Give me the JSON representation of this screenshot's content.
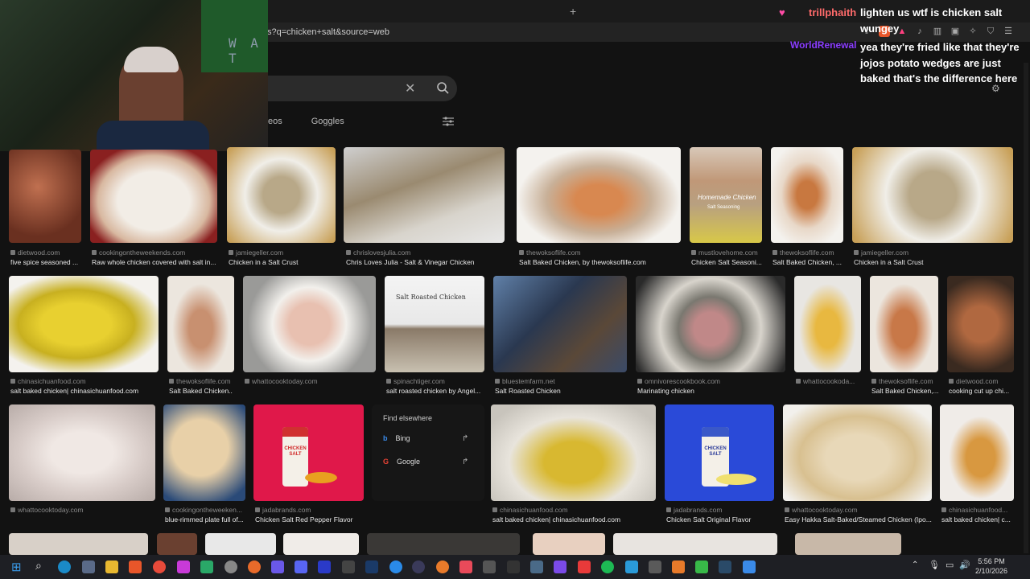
{
  "browser": {
    "url_text": "s?q=chicken+salt&source=web",
    "new_tab_label": "+"
  },
  "overlay": {
    "watermark_text": "W A T"
  },
  "search": {
    "clear_label": "✕",
    "tabs": [
      "eos",
      "Goggles"
    ]
  },
  "chat": {
    "lines": [
      {
        "user": "trillphaith",
        "text": "lighten us wtf is chicken salt"
      },
      {
        "user": "",
        "text": "wungey"
      },
      {
        "user": "WorldRenewal",
        "text": "yea they're fried like that they're jojos potato wedges are just baked that's the difference here"
      }
    ],
    "user_color_1": "#ff6b6b",
    "user_color_2": "#8a3cff"
  },
  "results": {
    "row1": [
      {
        "source": "dietwood.com",
        "caption": "five spice seasoned ..."
      },
      {
        "source": "cookingontheweekends.com",
        "caption": "Raw whole chicken covered with salt in..."
      },
      {
        "source": "jamiegeller.com",
        "caption": "Chicken in a Salt Crust"
      },
      {
        "source": "chrislovesjulia.com",
        "caption": "Chris Loves Julia - Salt & Vinegar Chicken"
      },
      {
        "source": "thewoksoflife.com",
        "caption": "Salt Baked Chicken, by thewoksoflife.com"
      },
      {
        "source": "mustlovehome.com",
        "caption": "Chicken Salt Seasoni..."
      },
      {
        "source": "thewoksoflife.com",
        "caption": "Salt Baked Chicken, ..."
      },
      {
        "source": "jamiegeller.com",
        "caption": "Chicken in a Salt Crust"
      }
    ],
    "row2": [
      {
        "source": "chinasichuanfood.com",
        "caption": "salt baked chicken| chinasichuanfood.com"
      },
      {
        "source": "thewoksoflife.com",
        "caption": "Salt Baked Chicken.."
      },
      {
        "source": "whattocooktoday.com",
        "caption": ""
      },
      {
        "source": "spinachtiger.com",
        "caption": "salt roasted chicken by Angel..."
      },
      {
        "source": "bluestemfarm.net",
        "caption": "Salt Roasted Chicken"
      },
      {
        "source": "omnivorescookbook.com",
        "caption": "Marinating chicken"
      },
      {
        "source": "whattocookoda...",
        "caption": ""
      },
      {
        "source": "thewoksoflife.com",
        "caption": "Salt Baked Chicken,..."
      },
      {
        "source": "dietwood.com",
        "caption": "cooking cut up chi..."
      }
    ],
    "row3": [
      {
        "source": "whattocooktoday.com",
        "caption": ""
      },
      {
        "source": "cookingontheweeken...",
        "caption": "blue-rimmed plate full of..."
      },
      {
        "source": "jadabrands.com",
        "caption": "Chicken Salt Red Pepper Flavor"
      },
      {
        "source": "chinasichuanfood.com",
        "caption": "salt baked chicken| chinasichuanfood.com"
      },
      {
        "source": "jadabrands.com",
        "caption": "Chicken Salt Original Flavor"
      },
      {
        "source": "whattocooktoday.com",
        "caption": "Easy Hakka Salt-Baked/Steamed Chicken (Ipo..."
      },
      {
        "source": "chinasichuanfood...",
        "caption": "salt baked chicken| c..."
      }
    ],
    "image_texts": {
      "seasoning_label": "Salt Seasoning",
      "homemade_label": "Homemade Chicken",
      "roasted_label": "Salt Roasted Chicken",
      "jar_text": "CHICKEN SALT"
    }
  },
  "find_elsewhere": {
    "title": "Find elsewhere",
    "items": [
      "Bing",
      "Google"
    ]
  },
  "taskbar": {
    "time": "5:56 PM",
    "date": "2/10/2026"
  }
}
